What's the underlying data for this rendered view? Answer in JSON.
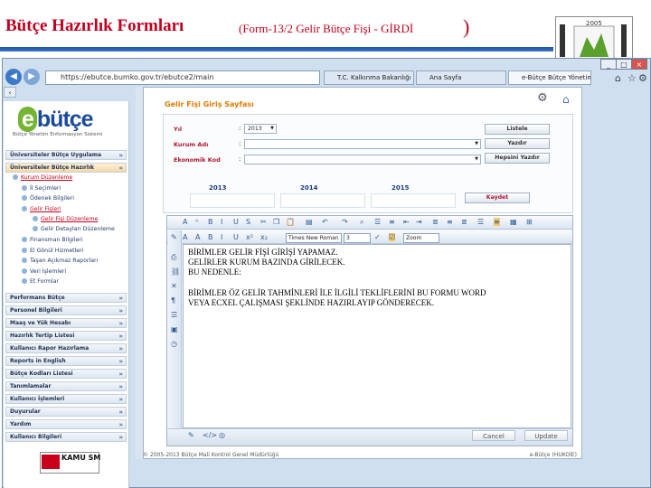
{
  "slide": {
    "title": "Bütçe Hazırlık Formları",
    "subtitle": "(Form-13/2 Gelir Bütçe Fişi - GİRDİ",
    "paren": ")",
    "logo_year": "2005"
  },
  "browser": {
    "address": "https://ebutce.bumko.gov.tr/ebutce2/main",
    "tabs": [
      "T.C. Kalkınma Bakanlığı | ...",
      "Ana Sayfa",
      "e-Bütçe Bütçe Yönetim..."
    ],
    "window_controls": [
      "_",
      "□",
      "×"
    ]
  },
  "sidebar": {
    "brand": "bütçe",
    "brand_e": "e",
    "brand_sub": "Bütçe Yönetim Enformasyon Sistemi",
    "sections_top": [
      {
        "label": "Üniversiteler Bütçe Uygulama"
      },
      {
        "label": "Üniversiteler Bütçe Hazırlık"
      }
    ],
    "items": [
      {
        "label": "Kurum Düzenleme"
      },
      {
        "label": "İl Seçimleri"
      },
      {
        "label": "Ödenek Bilgileri"
      },
      {
        "label": "Gelir Fişleri"
      },
      {
        "label": "Gelir Fişi Düzenleme"
      },
      {
        "label": "Gelir Detayları Düzenleme"
      },
      {
        "label": "Finansman Bilgileri"
      },
      {
        "label": "El Gönül Hizmetleri"
      },
      {
        "label": "Taşan Açıkmaz Raporları"
      },
      {
        "label": "Veri İşlemleri"
      },
      {
        "label": "Et Formlar"
      }
    ],
    "sections_bottom": [
      {
        "label": "Performans Bütçe"
      },
      {
        "label": "Personel Bilgileri"
      },
      {
        "label": "Maaş ve Yük Hesabı"
      },
      {
        "label": "Hazırlık Tertip Listesi"
      },
      {
        "label": "Kullanıcı Rapor Hazırlama"
      },
      {
        "label": "Reports in English"
      },
      {
        "label": "Bütçe Kodları Listesi"
      },
      {
        "label": "Tanımlamalar"
      },
      {
        "label": "Kullanıcı İşlemleri"
      },
      {
        "label": "Duyurular"
      },
      {
        "label": "Yardım"
      },
      {
        "label": "Kullanıcı Bilgileri"
      }
    ],
    "kamu_logo": "KAMU SM"
  },
  "form": {
    "title": "Gelir Fişi Giriş Sayfası",
    "fields": [
      {
        "label": "Yıl",
        "value": "2013"
      },
      {
        "label": "Kurum Adı",
        "value": ""
      },
      {
        "label": "Ekonomik Kod",
        "value": ""
      }
    ],
    "buttons": {
      "list": "Listele",
      "print": "Yazdır",
      "print_all": "Hepsini Yazdır",
      "save": "Kaydet"
    },
    "years": [
      "2013",
      "2014",
      "2015"
    ]
  },
  "editor": {
    "font_name": "Times New Roman",
    "font_size": "3",
    "zoom": "Zoom",
    "lines": [
      "BİRİMLER GELİR FİŞİ GİRİŞİ YAPAMAZ.",
      "GELİRLER KURUM BAZINDA GİRİLECEK.",
      "BU NEDENLE:",
      "",
      "BİRİMLER ÖZ GELİR TAHMİNLERİ İLE İLGİLİ TEKLİFLERİNİ BU FORMU WORD",
      "VEYA ECXEL ÇALIŞMASI ŞEKLİNDE HAZIRLAYIP GÖNDERECEK."
    ],
    "cancel": "Cancel",
    "update": "Update"
  },
  "footer": {
    "left": "© 2005-2013 Bütçe Mali Kontrol Genel Müdürlüğü",
    "right": "e-Bütçe (HUKOİE)"
  }
}
